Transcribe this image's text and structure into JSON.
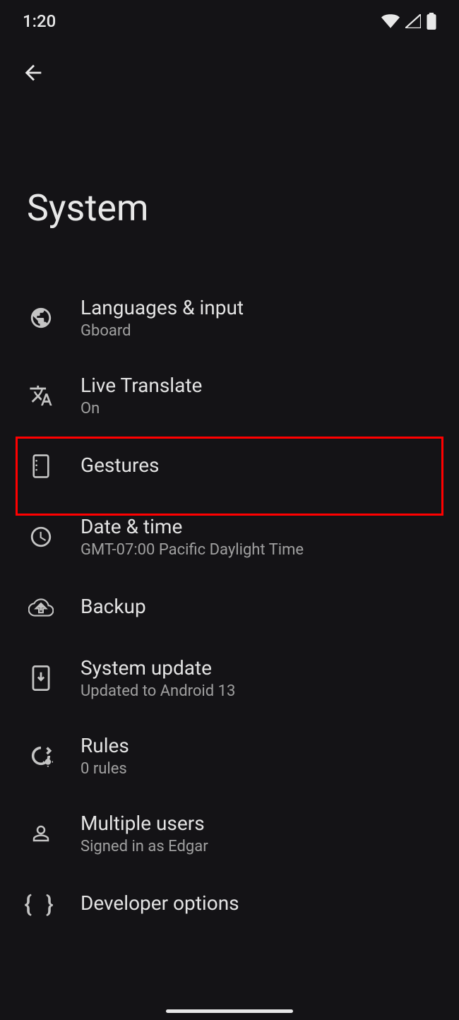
{
  "statusBar": {
    "time": "1:20"
  },
  "page": {
    "title": "System"
  },
  "highlightedItem": "gestures",
  "items": [
    {
      "id": "languages",
      "title": "Languages & input",
      "subtitle": "Gboard"
    },
    {
      "id": "translate",
      "title": "Live Translate",
      "subtitle": "On"
    },
    {
      "id": "gestures",
      "title": "Gestures",
      "subtitle": ""
    },
    {
      "id": "datetime",
      "title": "Date & time",
      "subtitle": "GMT-07:00 Pacific Daylight Time"
    },
    {
      "id": "backup",
      "title": "Backup",
      "subtitle": ""
    },
    {
      "id": "update",
      "title": "System update",
      "subtitle": "Updated to Android 13"
    },
    {
      "id": "rules",
      "title": "Rules",
      "subtitle": "0 rules"
    },
    {
      "id": "users",
      "title": "Multiple users",
      "subtitle": "Signed in as Edgar"
    },
    {
      "id": "developer",
      "title": "Developer options",
      "subtitle": ""
    }
  ]
}
